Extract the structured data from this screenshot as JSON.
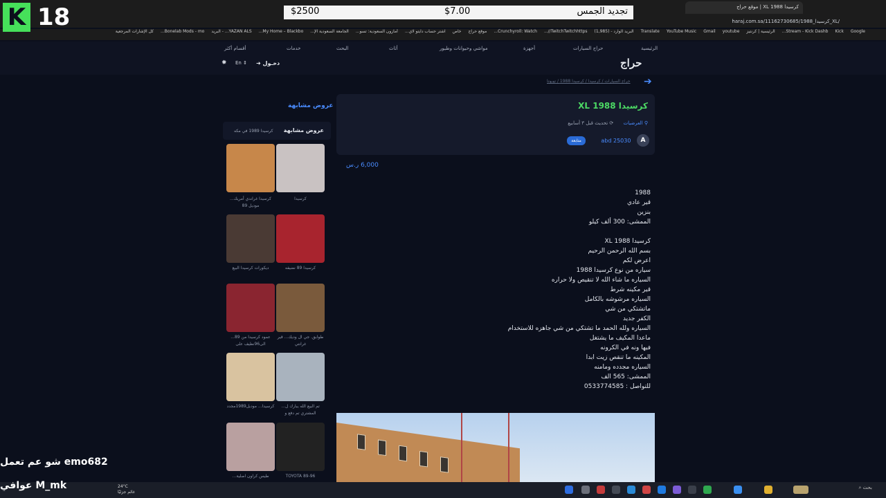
{
  "browser": {
    "tab_title": "كرسيدا XL 1988 | موقع حراج",
    "url": "haraj.com.sa/11162730685/كرسيدا_1988_XL/",
    "bookmarks": [
      "Google",
      "Kick",
      "Stream - Kick Dashb...",
      "الرئيسية | كرنتيز",
      "youtube",
      "Gmail",
      "YouTube Music",
      "Translate",
      "البريد الوارد - (1,985)",
      "TwitchTwitchhttps//...",
      "Crunchyroll: Watch...",
      "موقع حراج",
      "خاص",
      "اشتر حساب دايتو لاي...",
      "أمازون السعودية: تسو...",
      "الجامعة السعودية الإ...",
      "My Home – Blackbo...",
      "YAZAN ALS... - البريد",
      "Bonelab Mods - mo...",
      "كل الإشارات المرجعية"
    ]
  },
  "nav": {
    "home": "الرئيسية",
    "cars": "حراج السيارات",
    "devices": "أجهزة",
    "livestock": "مواشي وحيوانات وطيور",
    "furniture": "أثاث",
    "search": "البحث",
    "services": "خدمات",
    "sections": "أقسام أكثر",
    "logo": "حراج",
    "login": "دخـول",
    "lang": "En"
  },
  "breadcrumb": "حراج السيارات / كرسيدا / كرسيدا 1988 / تويوتا",
  "post": {
    "title": "كرسيدا XL 1988",
    "location": "العرضيات",
    "updated": "تحديث قبل ٣ أسابيع",
    "author_initial": "A",
    "author": "abd 25030",
    "badge": "متابعة",
    "price": "6,000",
    "currency": "ر.س",
    "description": "1988\nقير عادي\nبنزين\nالممشى: 300 ألف كيلو\n\nكرسيدا XL 1988\nبسم الله الرحمن الرحيم\nاعرض لكم\nسياره من نوع كرسيدا 1988\nالسياره ما شاء الله لا تنقيص ولا حراره\nقير مكينه شرط\nالسياره مرشوشه بالكامل\nماتشتكي من شي\nالكفر جديد\nالسياره ولله الحمد ما تشتكي من شي جاهزه للاستخدام\nماعدا المكيف ما يشتغل\nفيها ونه في الكرونه\nالمكينه ما تنقص زيت ابدا\nالسياره مجدده ومامنه\nالممشى: 565 الف\nللتواصل : 0533774585"
  },
  "sidebar": {
    "heading": "عروض مشابهة",
    "tab_main": "عروض مشابهة",
    "tab_city": "كرسيدا 1989 في مكه",
    "items": [
      {
        "caption": "كرسيدا",
        "color": "#c9c2c2"
      },
      {
        "caption": "كرسيدا غراندي أمريك... موديل 89",
        "color": "#c7874a"
      },
      {
        "caption": "كرسيدا 89 نضيفه",
        "color": "#a8242e"
      },
      {
        "caption": "ديكورات كرسيدا البيع",
        "color": "#4a3a34"
      },
      {
        "caption": "طوابق. جي ال وديك... قير غرانتي",
        "color": "#7a5a3c"
      },
      {
        "caption": "عمود كرسيدا من 89... الى96نظيف على",
        "color": "#8a2530"
      },
      {
        "caption": "تم البيع الله يبارك ل... المشتري تم دفع و",
        "color": "#a9b3be"
      },
      {
        "caption": "كرسيدا... موديل1989مجدد",
        "color": "#d9c3a0"
      },
      {
        "caption": "TOYOTA 89-96",
        "color": "#222222"
      },
      {
        "caption": "طيس كراون اصلية...",
        "color": "#b9a0a0"
      }
    ]
  },
  "overlay": {
    "banner_left": "تجديد الجمس",
    "banner_mid": "$7.00",
    "banner_right": "$2500",
    "stream_logo": "K",
    "stream_number": "18",
    "chat1": "شو عم تعمل emo682",
    "chat2": "عوافي M_mk"
  },
  "taskbar": {
    "search": "بحث",
    "temp": "24°C",
    "weather": "غائم جزئيًا"
  }
}
